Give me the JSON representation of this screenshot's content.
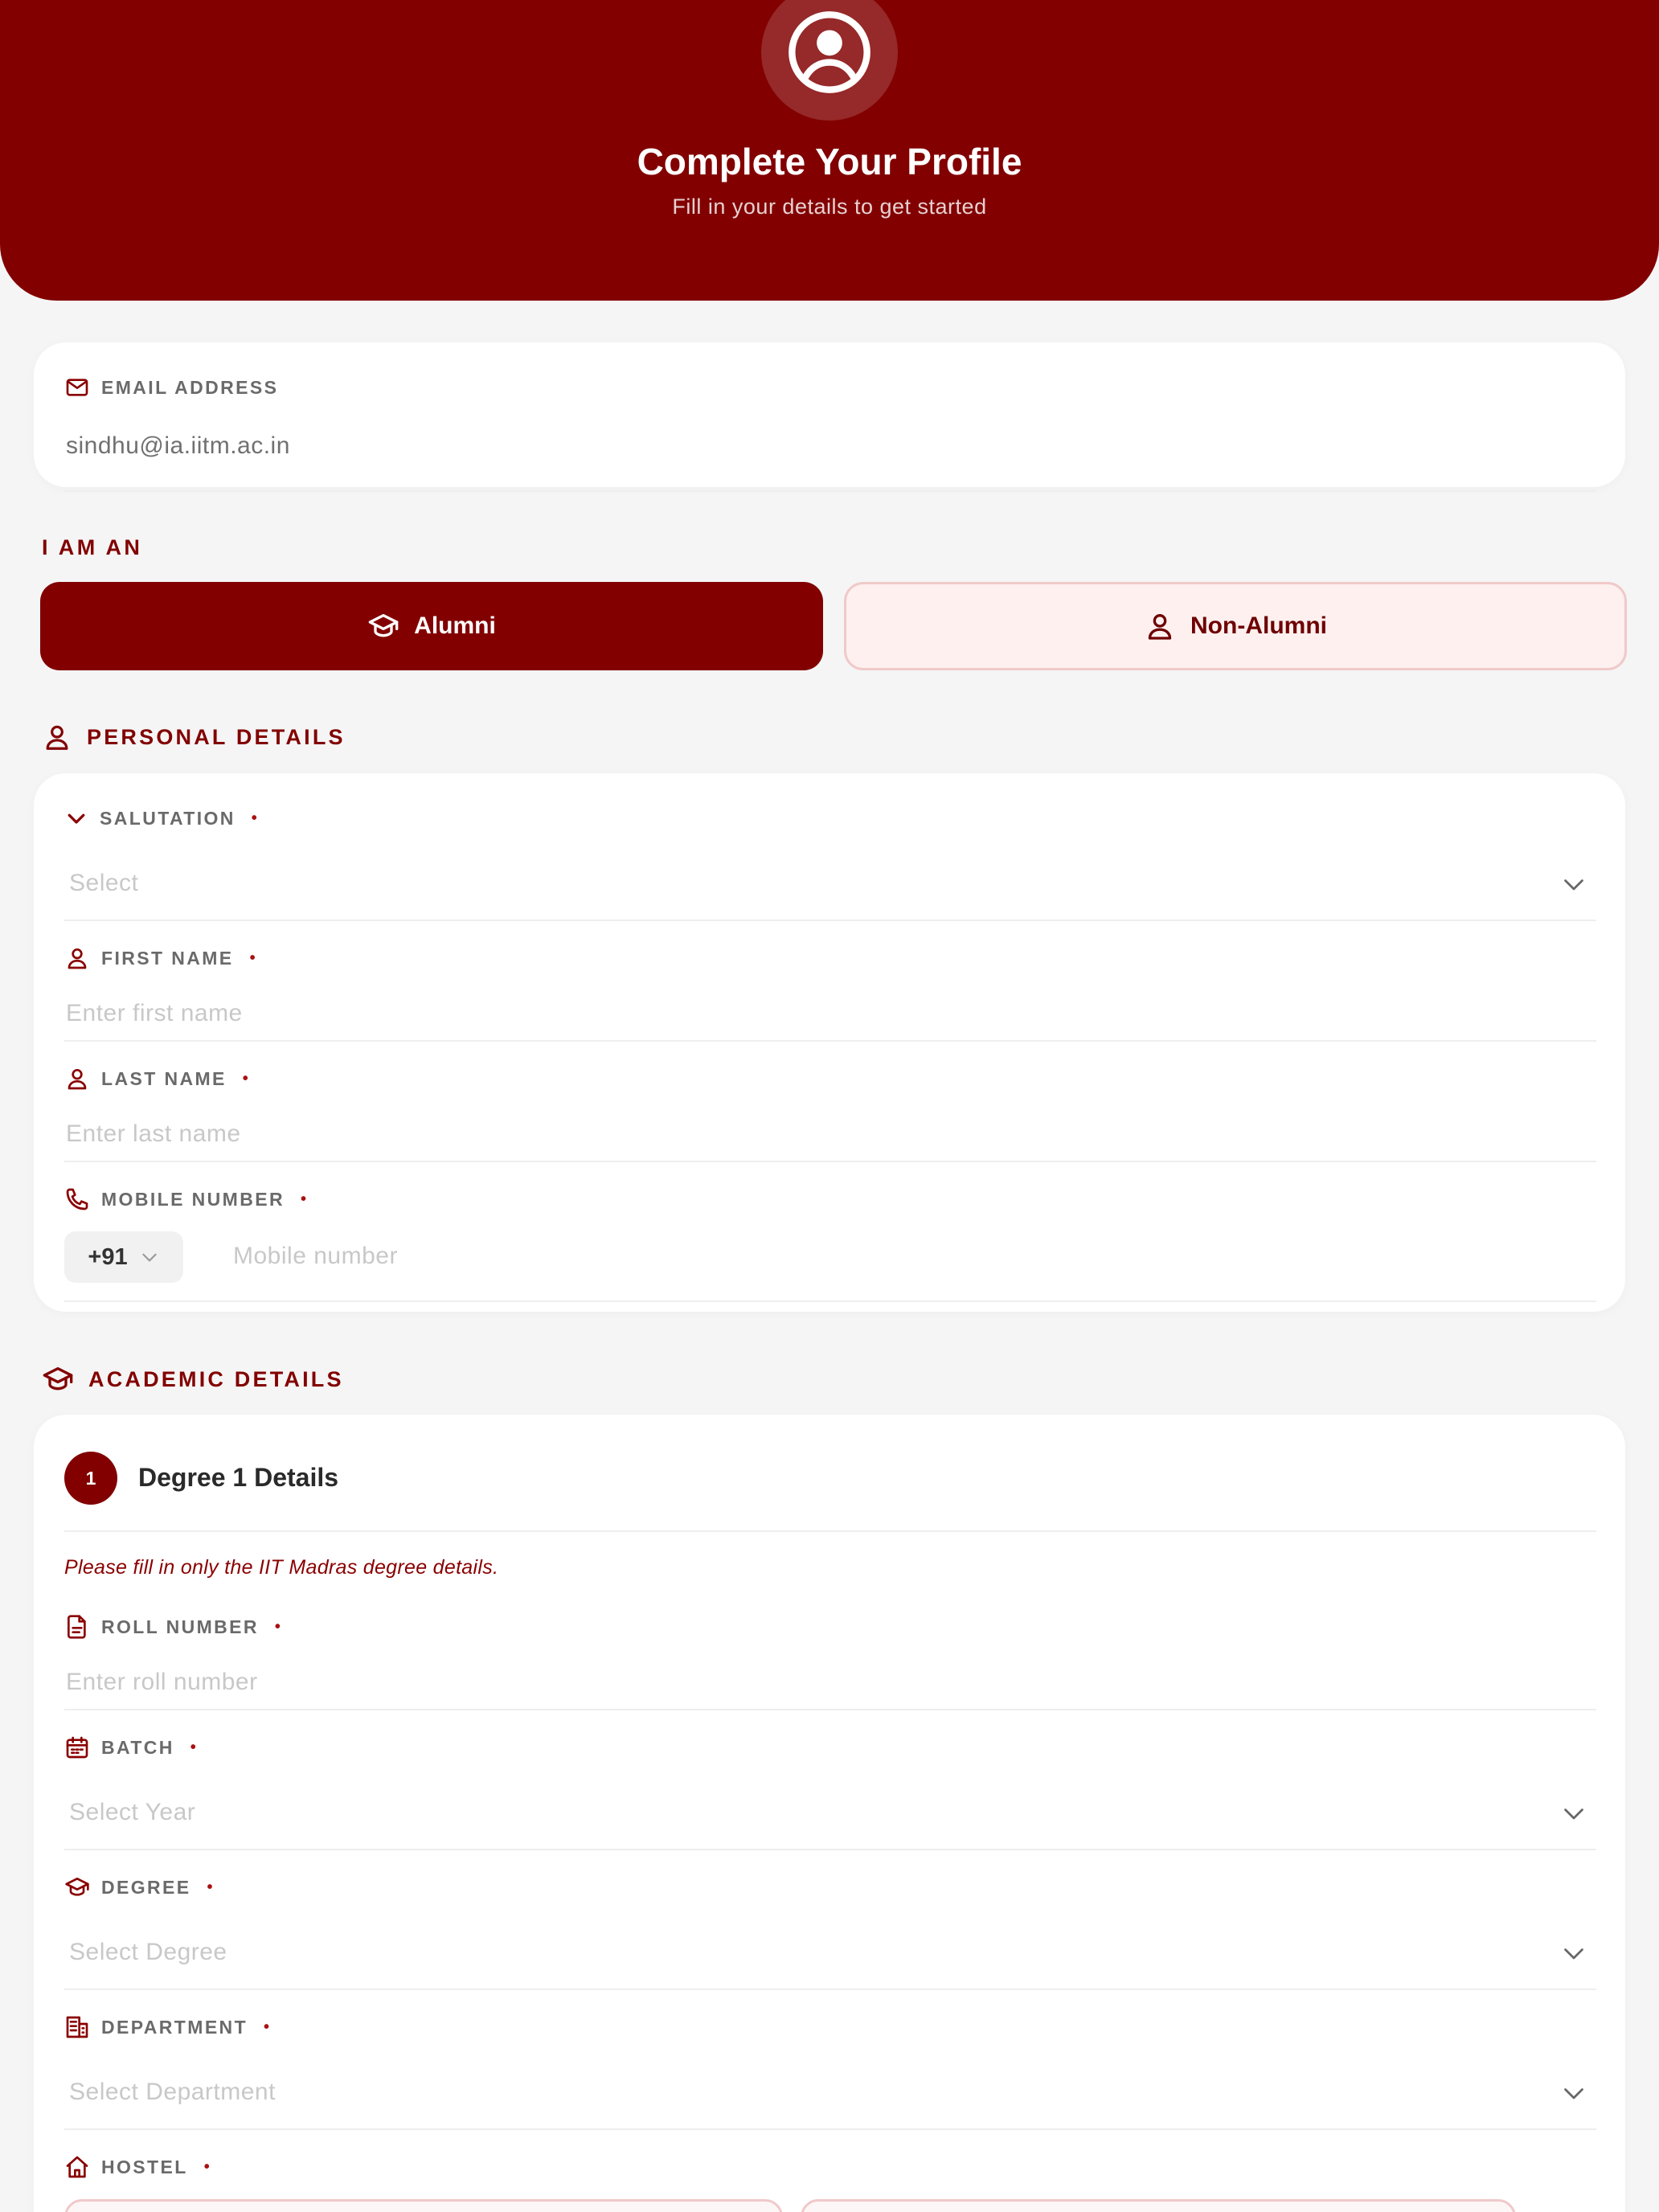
{
  "header": {
    "title": "Complete Your Profile",
    "subtitle": "Fill in your details to get started",
    "avatar_icon": "user-circle-icon",
    "background_color": "#820000"
  },
  "email": {
    "label": "EMAIL ADDRESS",
    "value": "sindhu@ia.iitm.ac.in",
    "icon": "mail-icon"
  },
  "role": {
    "label": "I AM AN",
    "options": [
      {
        "label": "Alumni",
        "icon": "graduation-cap-icon",
        "selected": true
      },
      {
        "label": "Non-Alumni",
        "icon": "user-icon",
        "selected": false
      }
    ]
  },
  "personal": {
    "heading": "PERSONAL DETAILS",
    "salutation": {
      "label": "SALUTATION",
      "required": "•",
      "placeholder": "Select"
    },
    "first_name": {
      "label": "FIRST NAME",
      "required": "•",
      "placeholder": "Enter first name"
    },
    "last_name": {
      "label": "LAST NAME",
      "required": "•",
      "placeholder": "Enter last name"
    },
    "mobile": {
      "label": "MOBILE NUMBER",
      "required": "•",
      "country_code": "+91",
      "placeholder": "Mobile number"
    }
  },
  "academic": {
    "heading": "ACADEMIC DETAILS",
    "degree_number": "1",
    "degree_title": "Degree 1 Details",
    "note": "Please fill in only the IIT Madras degree details.",
    "roll_number": {
      "label": "ROLL NUMBER",
      "required": "•",
      "placeholder": "Enter roll number"
    },
    "batch": {
      "label": "BATCH",
      "required": "•",
      "placeholder": "Select Year"
    },
    "degree": {
      "label": "DEGREE",
      "required": "•",
      "placeholder": "Select Degree"
    },
    "department": {
      "label": "DEPARTMENT",
      "required": "•",
      "placeholder": "Select Department"
    },
    "hostel": {
      "label": "HOSTEL",
      "required": "•"
    }
  },
  "colors": {
    "accent": "#820000",
    "accent_light": "#fdf0ef",
    "page_bg": "#f5f5f5"
  }
}
